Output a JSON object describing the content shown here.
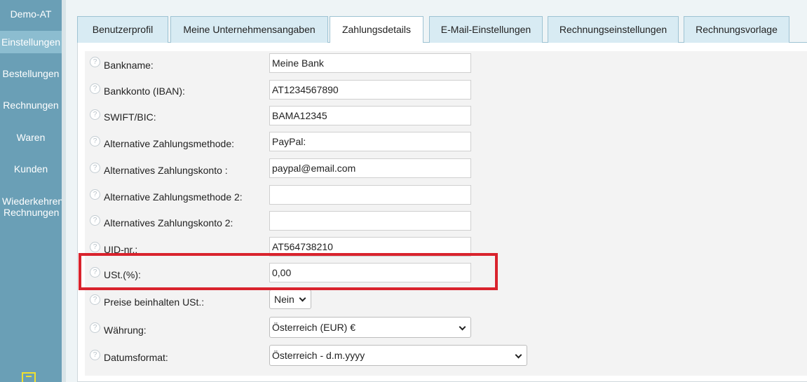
{
  "sidebar": {
    "brand": "Demo-AT",
    "items": [
      {
        "label": "Einstellungen",
        "active": true
      },
      {
        "label": "Bestellungen",
        "active": false
      },
      {
        "label": "Rechnungen",
        "active": false
      },
      {
        "label": "Waren",
        "active": false
      },
      {
        "label": "Kunden",
        "active": false
      },
      {
        "label_line1": "Wiederkehrende",
        "label_line2": "Rechnungen",
        "active": false
      }
    ]
  },
  "tabs": [
    {
      "label": "Benutzerprofil",
      "active": false
    },
    {
      "label": "Meine Unternehmensangaben",
      "active": false
    },
    {
      "label": "Zahlungsdetails",
      "active": true
    },
    {
      "label": "E-Mail-Einstellungen",
      "active": false
    },
    {
      "label": "Rechnungseinstellungen",
      "active": false
    },
    {
      "label": "Rechnungsvorlage",
      "active": false
    }
  ],
  "form": {
    "help_glyph": "?",
    "rows": [
      {
        "label": "Bankname:",
        "value": "Meine Bank"
      },
      {
        "label": "Bankkonto (IBAN):",
        "value": "AT1234567890"
      },
      {
        "label": "SWIFT/BIC:",
        "value": "BAMA12345"
      },
      {
        "label": "Alternative Zahlungsmethode:",
        "value": "PayPal:"
      },
      {
        "label": "Alternatives Zahlungskonto :",
        "value": "paypal@email.com"
      },
      {
        "label": "Alternative Zahlungsmethode 2:",
        "value": ""
      },
      {
        "label": "Alternatives Zahlungskonto 2:",
        "value": ""
      },
      {
        "label": "UID-nr.:",
        "value": "AT564738210"
      },
      {
        "label": "USt.(%):",
        "value": "0,00"
      },
      {
        "label": "Preise beinhalten USt.:",
        "selected": "Nein"
      },
      {
        "label": "Währung:",
        "selected": "Österreich (EUR) €"
      },
      {
        "label": "Datumsformat:",
        "selected": "Österreich - d.m.yyyy"
      }
    ]
  },
  "colors": {
    "sidebar": "#6a9fb6",
    "sidebar_active": "#8cbdd0",
    "tab": "#d8ebf3",
    "highlight": "#d9232d",
    "logout_icon": "#f0e030"
  },
  "icons": {
    "help": "help-circle-icon",
    "dropdown": "chevron-down-icon",
    "logout": "logout-icon"
  }
}
